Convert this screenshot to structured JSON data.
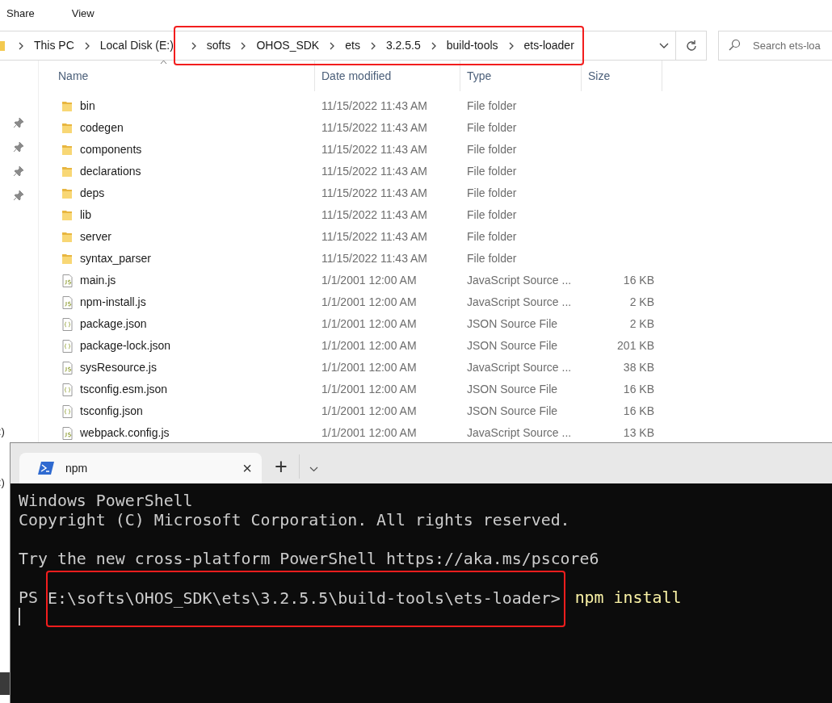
{
  "explorer": {
    "ribbon_tabs": [
      {
        "label": "Share"
      },
      {
        "label": "View"
      }
    ],
    "breadcrumb": [
      {
        "label": "This PC",
        "highlighted": false
      },
      {
        "label": "Local Disk (E:)",
        "highlighted": false
      },
      {
        "label": "softs",
        "highlighted": true
      },
      {
        "label": "OHOS_SDK",
        "highlighted": true
      },
      {
        "label": "ets",
        "highlighted": true
      },
      {
        "label": "3.2.5.5",
        "highlighted": true
      },
      {
        "label": "build-tools",
        "highlighted": true
      },
      {
        "label": "ets-loader",
        "highlighted": true
      }
    ],
    "search": {
      "placeholder": "Search ets-loa"
    },
    "nav_pane": [
      {
        "kind": "pin"
      },
      {
        "kind": "pin"
      },
      {
        "kind": "pin"
      },
      {
        "kind": "pin"
      },
      {
        "kind": "drive",
        "label": ":)"
      },
      {
        "kind": "drive",
        "label": ":)"
      }
    ],
    "columns": [
      "Name",
      "Date modified",
      "Type",
      "Size"
    ],
    "rows": [
      {
        "kind": "folder",
        "name": "bin",
        "date": "11/15/2022 11:43 AM",
        "type": "File folder"
      },
      {
        "kind": "folder",
        "name": "codegen",
        "date": "11/15/2022 11:43 AM",
        "type": "File folder"
      },
      {
        "kind": "folder",
        "name": "components",
        "date": "11/15/2022 11:43 AM",
        "type": "File folder"
      },
      {
        "kind": "folder",
        "name": "declarations",
        "date": "11/15/2022 11:43 AM",
        "type": "File folder"
      },
      {
        "kind": "folder",
        "name": "deps",
        "date": "11/15/2022 11:43 AM",
        "type": "File folder"
      },
      {
        "kind": "folder",
        "name": "lib",
        "date": "11/15/2022 11:43 AM",
        "type": "File folder"
      },
      {
        "kind": "folder",
        "name": "server",
        "date": "11/15/2022 11:43 AM",
        "type": "File folder"
      },
      {
        "kind": "folder",
        "name": "syntax_parser",
        "date": "11/15/2022 11:43 AM",
        "type": "File folder"
      },
      {
        "kind": "js",
        "name": "main.js",
        "date": "1/1/2001 12:00 AM",
        "type": "JavaScript Source ...",
        "size": "16 KB"
      },
      {
        "kind": "js",
        "name": "npm-install.js",
        "date": "1/1/2001 12:00 AM",
        "type": "JavaScript Source ...",
        "size": "2 KB"
      },
      {
        "kind": "json",
        "name": "package.json",
        "date": "1/1/2001 12:00 AM",
        "type": "JSON Source File",
        "size": "2 KB"
      },
      {
        "kind": "json",
        "name": "package-lock.json",
        "date": "1/1/2001 12:00 AM",
        "type": "JSON Source File",
        "size": "201 KB"
      },
      {
        "kind": "js",
        "name": "sysResource.js",
        "date": "1/1/2001 12:00 AM",
        "type": "JavaScript Source ...",
        "size": "38 KB"
      },
      {
        "kind": "json",
        "name": "tsconfig.esm.json",
        "date": "1/1/2001 12:00 AM",
        "type": "JSON Source File",
        "size": "16 KB"
      },
      {
        "kind": "json",
        "name": "tsconfig.json",
        "date": "1/1/2001 12:00 AM",
        "type": "JSON Source File",
        "size": "16 KB"
      },
      {
        "kind": "js",
        "name": "webpack.config.js",
        "date": "1/1/2001 12:00 AM",
        "type": "JavaScript Source ...",
        "size": "13 KB"
      }
    ]
  },
  "terminal": {
    "tab": {
      "title": "npm",
      "close": "×"
    },
    "new_tab": "+",
    "lines": [
      {
        "kind": "text",
        "text": "Windows PowerShell"
      },
      {
        "kind": "text",
        "text": "Copyright (C) Microsoft Corporation. All rights reserved."
      },
      {
        "kind": "blank"
      },
      {
        "kind": "text",
        "text": "Try the new cross-platform PowerShell https://aka.ms/pscore6"
      },
      {
        "kind": "blank"
      },
      {
        "kind": "prompt",
        "prefix": "PS",
        "path": "E:\\softs\\OHOS_SDK\\ets\\3.2.5.5\\build-tools\\ets-loader>",
        "command": "npm install",
        "highlighted": true
      },
      {
        "kind": "cursor"
      }
    ]
  }
}
